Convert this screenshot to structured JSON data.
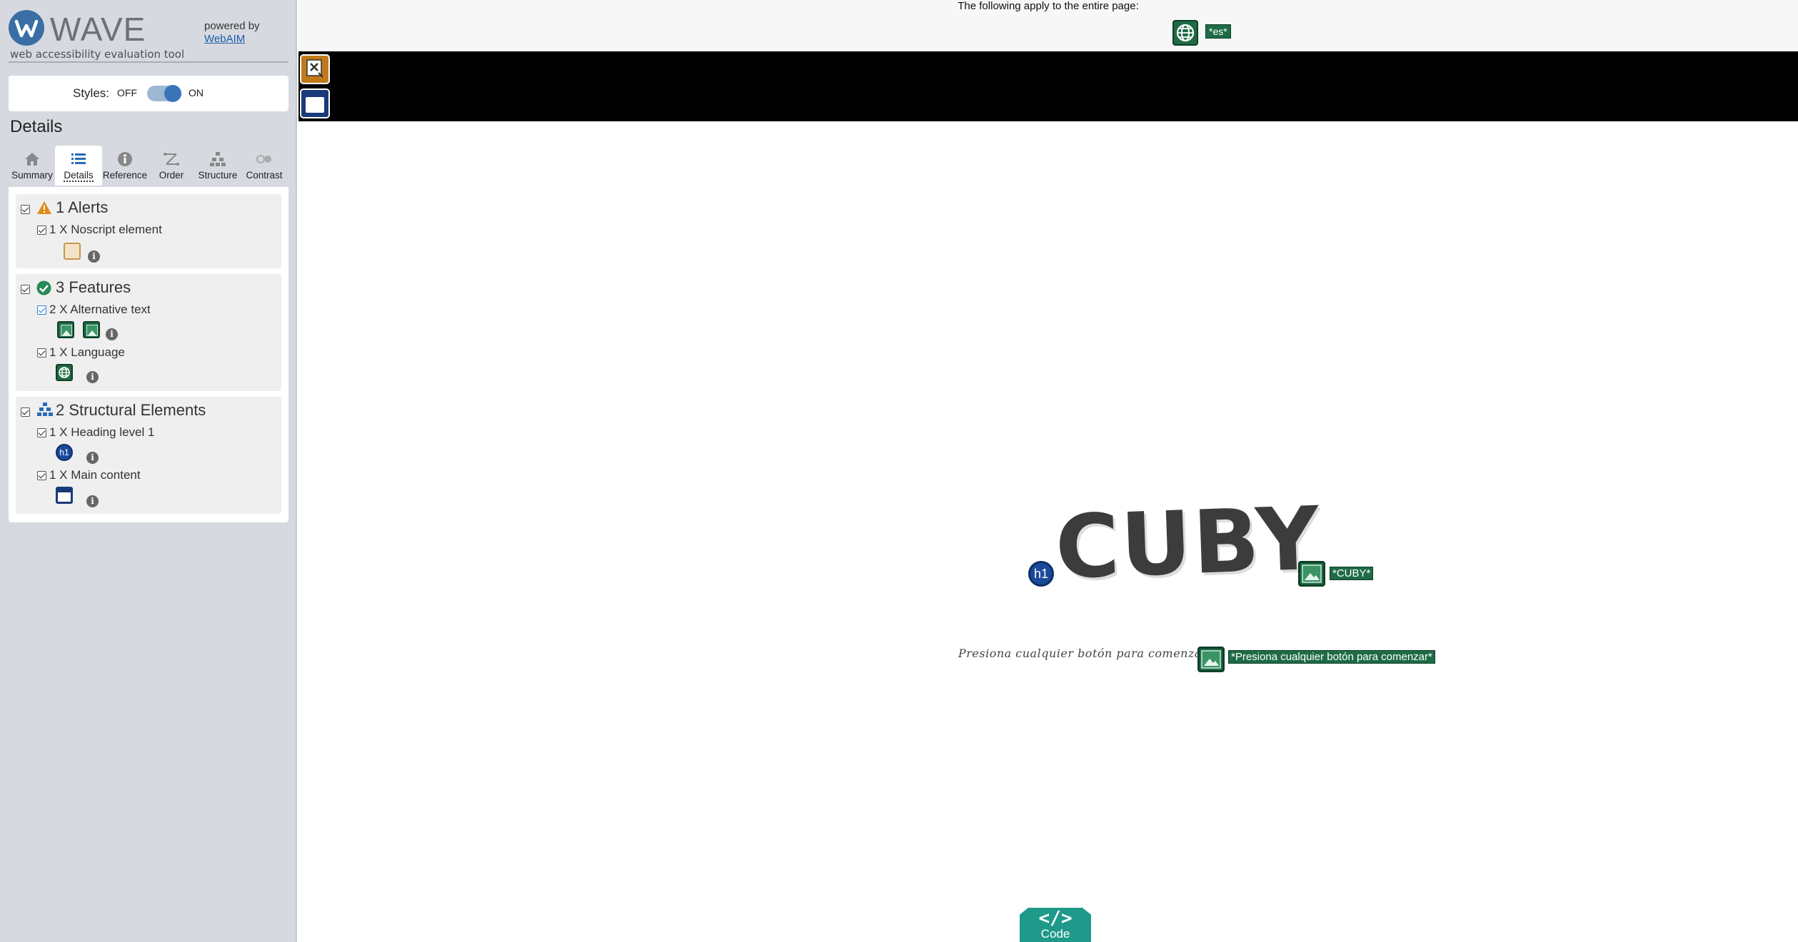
{
  "sidebar": {
    "logo": {
      "name": "WAVE",
      "tagline": "web accessibility evaluation tool"
    },
    "powered_by": {
      "text": "powered by",
      "link": "WebAIM"
    },
    "styles": {
      "label": "Styles:",
      "off": "OFF",
      "on": "ON",
      "state": "on"
    },
    "section_title": "Details",
    "tabs": [
      {
        "label": "Summary",
        "icon": "home-icon"
      },
      {
        "label": "Details",
        "icon": "list-icon",
        "active": true
      },
      {
        "label": "Reference",
        "icon": "info-icon"
      },
      {
        "label": "Order",
        "icon": "order-icon"
      },
      {
        "label": "Structure",
        "icon": "structure-icon"
      },
      {
        "label": "Contrast",
        "icon": "contrast-icon"
      }
    ],
    "groups": {
      "alerts": {
        "title": "1 Alerts",
        "items": [
          {
            "label": "1 X Noscript element"
          }
        ]
      },
      "features": {
        "title": "3 Features",
        "items": [
          {
            "label": "2 X Alternative text"
          },
          {
            "label": "1 X Language"
          }
        ]
      },
      "structural": {
        "title": "2 Structural Elements",
        "items": [
          {
            "label": "1 X Heading level 1"
          },
          {
            "label": "1 X Main content"
          }
        ]
      }
    }
  },
  "page": {
    "apply_text": "The following apply to the entire page:",
    "lang_badge": "*es*",
    "heading": "CUBY",
    "h1_badge": "h1",
    "cuby_alt": "*CUBY*",
    "press_text": "Presiona cualquier botón para comenzar",
    "press_alt": "*Presiona cualquier botón para comenzar*",
    "code_button": {
      "glyph": "</>",
      "label": "Code"
    }
  },
  "colors": {
    "sidebar_bg": "#d6dae0",
    "feature_green": "#1e6b45",
    "alert_orange": "#c07a1a",
    "structure_blue": "#1a3a7a",
    "code_teal": "#1f9a8a"
  }
}
